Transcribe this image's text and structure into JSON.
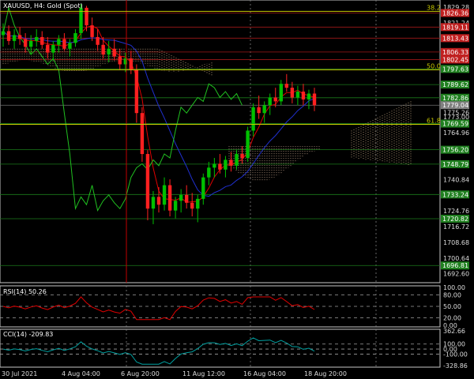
{
  "symbol_title": "XAUUSD, H4:  Gold (Spot)",
  "colors": {
    "background": "#000000",
    "frame": "#c8c8c8",
    "candle_up": "#00c000",
    "candle_down": "#ff2020",
    "tenkan": "#e00000",
    "kijun": "#2030d0",
    "chikou": "#20c020",
    "kumo_bull": "#d2b48c",
    "kumo_bear": "#c8a890",
    "fib": "#c8c800",
    "rsi_line": "#e00000",
    "cci_line": "#00a0a0"
  },
  "price_axis": {
    "ticks": [
      "1829.28",
      "1821.24",
      "1813.20",
      "1805.28",
      "1797.24",
      "1789.20",
      "1781.16",
      "1773.00",
      "1764.96",
      "1756.92",
      "1748.88",
      "1740.84",
      "1732.80",
      "1724.76",
      "1716.72",
      "1708.68",
      "1700.64",
      "1692.60"
    ]
  },
  "level_boxes": [
    {
      "label": "1826.36",
      "value": 1826.36,
      "bg": "#c02020"
    },
    {
      "label": "1819.11",
      "value": 1819.11,
      "bg": "#c02020"
    },
    {
      "label": "1813.43",
      "value": 1813.43,
      "bg": "#c02020"
    },
    {
      "label": "1806.33",
      "value": 1806.33,
      "bg": "#c02020"
    },
    {
      "label": "1802.45",
      "value": 1802.45,
      "bg": "#c02020"
    },
    {
      "label": "1797.63",
      "value": 1797.63,
      "bg": "#208020"
    },
    {
      "label": "1789.62",
      "value": 1789.62,
      "bg": "#208020"
    },
    {
      "label": "1782.86",
      "value": 1782.86,
      "bg": "#208020"
    },
    {
      "label": "1779.04",
      "value": 1779.04,
      "bg": "#808080"
    },
    {
      "label": "1769.59",
      "value": 1769.59,
      "bg": "#208020"
    },
    {
      "label": "1756.20",
      "value": 1756.2,
      "bg": "#208020"
    },
    {
      "label": "1748.79",
      "value": 1748.79,
      "bg": "#208020"
    },
    {
      "label": "1733.24",
      "value": 1733.24,
      "bg": "#208020"
    },
    {
      "label": "1720.82",
      "value": 1720.82,
      "bg": "#208020"
    },
    {
      "label": "1696.81",
      "value": 1696.81,
      "bg": "#208020"
    }
  ],
  "axis_labels_small": [
    {
      "label": "1781.86",
      "value": 1781.86
    },
    {
      "label": "1775.26",
      "value": 1775.26
    }
  ],
  "fib_levels": [
    {
      "label": "38.2",
      "value": 1827.2
    },
    {
      "label": "50.0",
      "value": 1797.2
    },
    {
      "label": "61.8",
      "value": 1769.2
    }
  ],
  "time_axis": {
    "labels": [
      "30 Jul 2021",
      "4 Aug 04:00",
      "6 Aug 20:00",
      "11 Aug 12:00",
      "16 Aug 04:00",
      "18 Aug 20:00"
    ]
  },
  "rsi": {
    "title": "RSI(14) 50.26",
    "ticks": [
      "100.00",
      "80.00",
      "50.00",
      "20.00",
      "0.00"
    ],
    "levels": [
      80,
      50,
      20
    ]
  },
  "cci": {
    "title": "CCI(14) -209.83",
    "ticks": [
      "362.66",
      "100.00",
      "0.00",
      "-100.00",
      "-328.86"
    ],
    "levels": [
      100,
      0,
      -100
    ]
  },
  "chart_data": {
    "type": "candlestick",
    "title": "XAUUSD, H4:  Gold (Spot)",
    "ylim": [
      1688,
      1833
    ],
    "candles": [
      [
        1815,
        1821,
        1809,
        1817
      ],
      [
        1817,
        1820,
        1810,
        1812
      ],
      [
        1812,
        1818,
        1808,
        1815
      ],
      [
        1815,
        1819,
        1810,
        1813
      ],
      [
        1813,
        1816,
        1806,
        1809
      ],
      [
        1809,
        1815,
        1805,
        1812
      ],
      [
        1812,
        1818,
        1809,
        1814
      ],
      [
        1814,
        1817,
        1808,
        1810
      ],
      [
        1810,
        1814,
        1803,
        1806
      ],
      [
        1806,
        1812,
        1802,
        1810
      ],
      [
        1810,
        1815,
        1806,
        1813
      ],
      [
        1813,
        1816,
        1807,
        1808
      ],
      [
        1808,
        1813,
        1804,
        1811
      ],
      [
        1811,
        1818,
        1809,
        1816
      ],
      [
        1816,
        1831,
        1813,
        1829
      ],
      [
        1829,
        1830,
        1817,
        1820
      ],
      [
        1820,
        1824,
        1812,
        1814
      ],
      [
        1814,
        1818,
        1807,
        1810
      ],
      [
        1810,
        1814,
        1803,
        1805
      ],
      [
        1805,
        1812,
        1801,
        1808
      ],
      [
        1808,
        1813,
        1802,
        1804
      ],
      [
        1804,
        1808,
        1797,
        1800
      ],
      [
        1800,
        1806,
        1796,
        1803
      ],
      [
        1803,
        1807,
        1795,
        1797
      ],
      [
        1797,
        1800,
        1770,
        1775
      ],
      [
        1775,
        1778,
        1750,
        1754
      ],
      [
        1754,
        1756,
        1720,
        1726
      ],
      [
        1726,
        1735,
        1718,
        1732
      ],
      [
        1732,
        1737,
        1724,
        1728
      ],
      [
        1728,
        1742,
        1725,
        1738
      ],
      [
        1738,
        1741,
        1722,
        1725
      ],
      [
        1725,
        1732,
        1721,
        1730
      ],
      [
        1730,
        1736,
        1724,
        1733
      ],
      [
        1733,
        1738,
        1726,
        1729
      ],
      [
        1729,
        1734,
        1722,
        1726
      ],
      [
        1726,
        1733,
        1719,
        1731
      ],
      [
        1731,
        1744,
        1728,
        1742
      ],
      [
        1742,
        1750,
        1738,
        1747
      ],
      [
        1747,
        1752,
        1742,
        1749
      ],
      [
        1749,
        1754,
        1744,
        1746
      ],
      [
        1746,
        1753,
        1742,
        1751
      ],
      [
        1751,
        1755,
        1745,
        1748
      ],
      [
        1748,
        1756,
        1746,
        1754
      ],
      [
        1754,
        1758,
        1749,
        1752
      ],
      [
        1752,
        1768,
        1750,
        1766
      ],
      [
        1766,
        1780,
        1763,
        1778
      ],
      [
        1778,
        1784,
        1772,
        1775
      ],
      [
        1775,
        1781,
        1770,
        1779
      ],
      [
        1779,
        1785,
        1774,
        1783
      ],
      [
        1783,
        1788,
        1778,
        1781
      ],
      [
        1781,
        1792,
        1779,
        1790
      ],
      [
        1790,
        1795,
        1786,
        1788
      ],
      [
        1788,
        1791,
        1780,
        1783
      ],
      [
        1783,
        1789,
        1779,
        1786
      ],
      [
        1786,
        1790,
        1779,
        1782
      ],
      [
        1782,
        1787,
        1777,
        1785
      ],
      [
        1785,
        1788,
        1776,
        1779
      ]
    ]
  }
}
